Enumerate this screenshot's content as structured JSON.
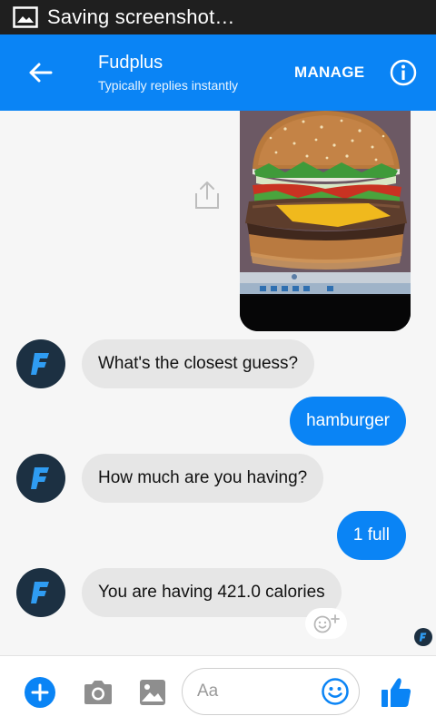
{
  "status_bar": {
    "text": "Saving screenshot…",
    "icon": "image-icon"
  },
  "header": {
    "title": "Fudplus",
    "subtitle": "Typically replies instantly",
    "manage_label": "MANAGE",
    "accent_color": "#0a84f5"
  },
  "messages": [
    {
      "from": "bot",
      "text": "What's the closest guess?"
    },
    {
      "from": "user",
      "text": "hamburger"
    },
    {
      "from": "bot",
      "text": "How much are you having?"
    },
    {
      "from": "user",
      "text": "1 full"
    },
    {
      "from": "bot",
      "text": "You are having 421.0 calories"
    }
  ],
  "bot_avatar_letter": "F",
  "composer": {
    "placeholder": "Aa",
    "icons": [
      "plus-icon",
      "camera-icon",
      "gallery-icon",
      "emoji-icon",
      "thumbs-up-icon"
    ]
  }
}
